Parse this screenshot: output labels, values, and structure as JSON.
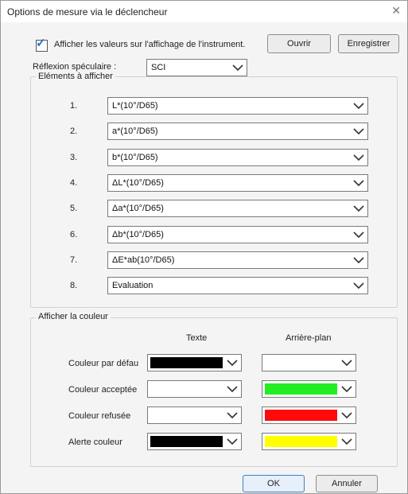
{
  "window": {
    "title": "Options de mesure via le déclencheur"
  },
  "top": {
    "show_values_label": "Afficher les valeurs sur l'affichage de l'instrument.",
    "show_values_checked": true,
    "open_label": "Ouvrir",
    "save_label": "Enregistrer",
    "specular_label": "Réflexion spéculaire :",
    "specular_value": "SCI"
  },
  "elements": {
    "group_label": "Eléments à afficher",
    "items": [
      {
        "num": "1.",
        "value": "L*(10°/D65)"
      },
      {
        "num": "2.",
        "value": "a*(10°/D65)"
      },
      {
        "num": "3.",
        "value": "b*(10°/D65)"
      },
      {
        "num": "4.",
        "value": "ΔL*(10°/D65)"
      },
      {
        "num": "5.",
        "value": "Δa*(10°/D65)"
      },
      {
        "num": "6.",
        "value": "Δb*(10°/D65)"
      },
      {
        "num": "7.",
        "value": "ΔE*ab(10°/D65)"
      },
      {
        "num": "8.",
        "value": "Evaluation"
      }
    ]
  },
  "colors": {
    "group_label": "Afficher la couleur",
    "text_header": "Texte",
    "background_header": "Arrière-plan",
    "rows": [
      {
        "label": "Couleur par défau",
        "text_color": "#000000",
        "bg_color": "#ffffff"
      },
      {
        "label": "Couleur acceptée",
        "text_color": "#ffffff",
        "bg_color": "#22ee22"
      },
      {
        "label": "Couleur refusée",
        "text_color": "#ffffff",
        "bg_color": "#ff0a0a"
      },
      {
        "label": "Alerte couleur",
        "text_color": "#000000",
        "bg_color": "#ffff00"
      }
    ]
  },
  "footer": {
    "ok_label": "OK",
    "cancel_label": "Annuler"
  },
  "icons": {
    "checkbox": "check-icon",
    "dropdown": "chevron-down-icon",
    "close": "close-icon"
  }
}
